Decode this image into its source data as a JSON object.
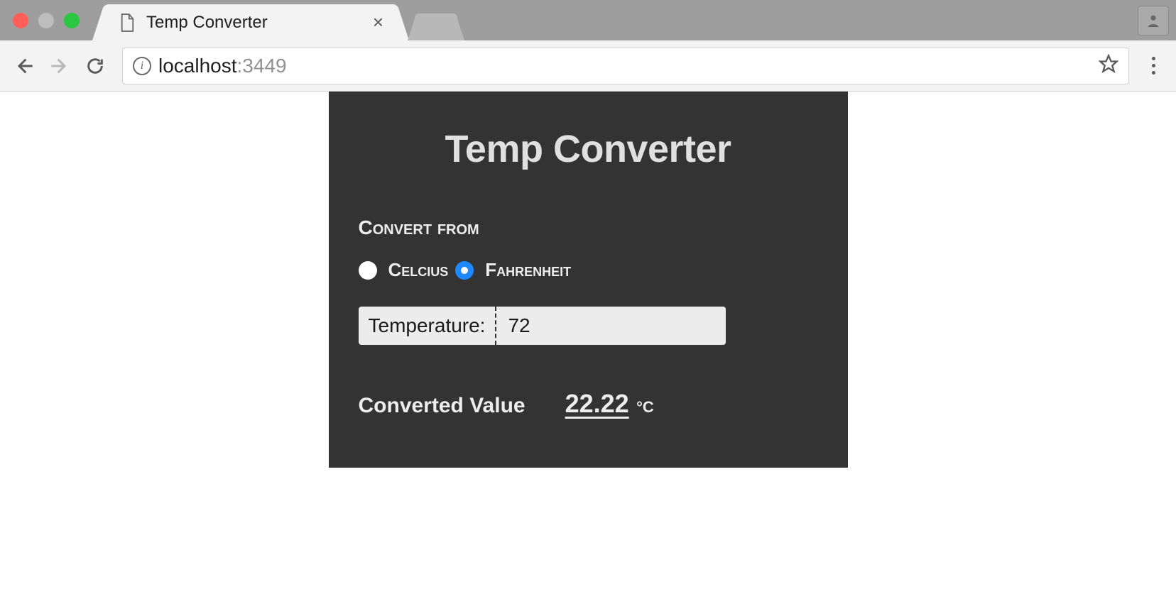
{
  "browser": {
    "tab_title": "Temp Converter",
    "url_host": "localhost",
    "url_port": ":3449"
  },
  "app": {
    "title": "Temp Converter",
    "convert_from_label": "Convert from",
    "options": {
      "celcius": "Celcius",
      "fahrenheit": "Fahrenheit"
    },
    "selected_option": "fahrenheit",
    "input_label": "Temperature:",
    "input_value": "72",
    "result_label": "Converted Value",
    "result_value": "22.22",
    "result_unit": "°C"
  }
}
